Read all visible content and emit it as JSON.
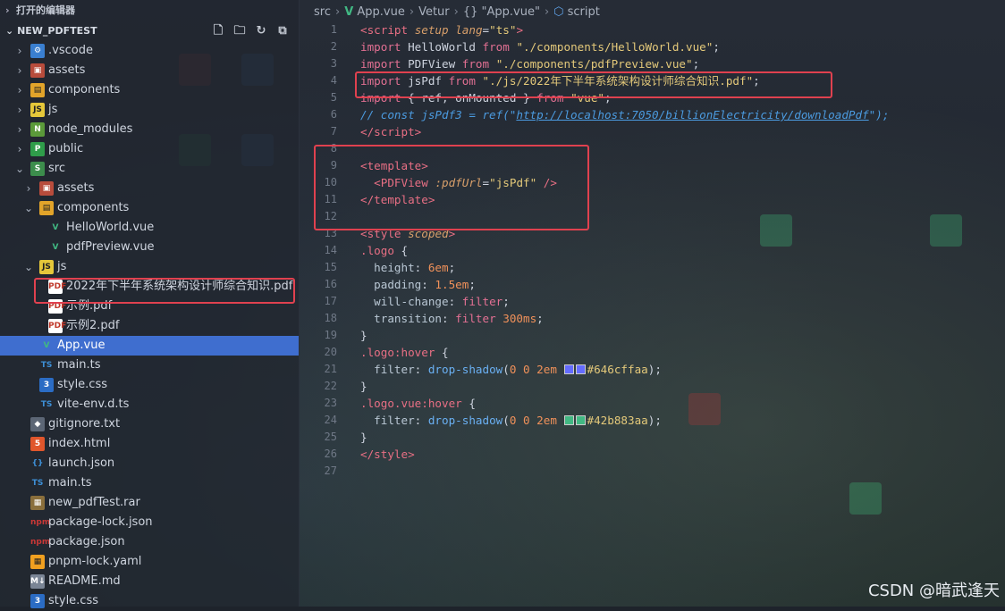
{
  "sidebar": {
    "open_editors_label": "打开的编辑器",
    "project_label": "NEW_PDFTEST",
    "action_icons": [
      "new-file-icon",
      "new-folder-icon",
      "refresh-icon",
      "collapse-all-icon"
    ],
    "items": [
      {
        "label": ".vscode",
        "depth": 0,
        "chev": "›",
        "icon": "vscode"
      },
      {
        "label": "assets",
        "depth": 0,
        "chev": "›",
        "icon": "assets"
      },
      {
        "label": "components",
        "depth": 0,
        "chev": "›",
        "icon": "comp"
      },
      {
        "label": "js",
        "depth": 0,
        "chev": "›",
        "icon": "js"
      },
      {
        "label": "node_modules",
        "depth": 0,
        "chev": "›",
        "icon": "node"
      },
      {
        "label": "public",
        "depth": 0,
        "chev": "›",
        "icon": "public"
      },
      {
        "label": "src",
        "depth": 0,
        "chev": "⌄",
        "icon": "src"
      },
      {
        "label": "assets",
        "depth": 1,
        "chev": "›",
        "icon": "assets"
      },
      {
        "label": "components",
        "depth": 1,
        "chev": "⌄",
        "icon": "comp"
      },
      {
        "label": "HelloWorld.vue",
        "depth": 2,
        "chev": "",
        "icon": "vue"
      },
      {
        "label": "pdfPreview.vue",
        "depth": 2,
        "chev": "",
        "icon": "vue"
      },
      {
        "label": "js",
        "depth": 1,
        "chev": "⌄",
        "icon": "js"
      },
      {
        "label": "2022年下半年系统架构设计师综合知识.pdf",
        "depth": 2,
        "chev": "",
        "icon": "pdf"
      },
      {
        "label": "示例.pdf",
        "depth": 2,
        "chev": "",
        "icon": "pdf"
      },
      {
        "label": "示例2.pdf",
        "depth": 2,
        "chev": "",
        "icon": "pdf"
      },
      {
        "label": "App.vue",
        "depth": 1,
        "chev": "",
        "icon": "vue",
        "selected": true
      },
      {
        "label": "main.ts",
        "depth": 1,
        "chev": "",
        "icon": "ts"
      },
      {
        "label": "style.css",
        "depth": 1,
        "chev": "",
        "icon": "css"
      },
      {
        "label": "vite-env.d.ts",
        "depth": 1,
        "chev": "",
        "icon": "ts"
      },
      {
        "label": "gitignore.txt",
        "depth": 0,
        "chev": "",
        "icon": "git"
      },
      {
        "label": "index.html",
        "depth": 0,
        "chev": "",
        "icon": "html"
      },
      {
        "label": "launch.json",
        "depth": 0,
        "chev": "",
        "icon": "json"
      },
      {
        "label": "main.ts",
        "depth": 0,
        "chev": "",
        "icon": "ts"
      },
      {
        "label": "new_pdfTest.rar",
        "depth": 0,
        "chev": "",
        "icon": "rar"
      },
      {
        "label": "package-lock.json",
        "depth": 0,
        "chev": "",
        "icon": "lock"
      },
      {
        "label": "package.json",
        "depth": 0,
        "chev": "",
        "icon": "lock"
      },
      {
        "label": "pnpm-lock.yaml",
        "depth": 0,
        "chev": "",
        "icon": "yaml"
      },
      {
        "label": "README.md",
        "depth": 0,
        "chev": "",
        "icon": "md"
      },
      {
        "label": "style.css",
        "depth": 0,
        "chev": "",
        "icon": "css"
      }
    ]
  },
  "breadcrumb": {
    "items": [
      "src",
      "App.vue",
      "Vetur",
      "{} \"App.vue\"",
      "script"
    ]
  },
  "editor": {
    "lines": [
      [
        [
          "<",
          "tag"
        ],
        [
          "script",
          "tag"
        ],
        [
          " ",
          ""
        ],
        [
          "setup",
          "attr"
        ],
        [
          " ",
          ""
        ],
        [
          "lang",
          "attr"
        ],
        [
          "=",
          ""
        ],
        [
          "\"ts\"",
          "str"
        ],
        [
          ">",
          "tag"
        ]
      ],
      [
        [
          "import",
          "kw"
        ],
        [
          " HelloWorld ",
          ""
        ],
        [
          "from",
          "kw"
        ],
        [
          " ",
          ""
        ],
        [
          "\"./components/HelloWorld.vue\"",
          "str"
        ],
        [
          ";",
          ""
        ]
      ],
      [
        [
          "import",
          "kw"
        ],
        [
          " PDFView ",
          ""
        ],
        [
          "from",
          "kw"
        ],
        [
          " ",
          ""
        ],
        [
          "\"./components/pdfPreview.vue\"",
          "str"
        ],
        [
          ";",
          ""
        ]
      ],
      [
        [
          "import",
          "kw"
        ],
        [
          " jsPdf ",
          ""
        ],
        [
          "from",
          "kw"
        ],
        [
          " ",
          ""
        ],
        [
          "\"./js/2022年下半年系统架构设计师综合知识.pdf\"",
          "str"
        ],
        [
          ";",
          ""
        ]
      ],
      [
        [
          "import",
          "kw"
        ],
        [
          " { ref, onMounted } ",
          ""
        ],
        [
          "from",
          "kw"
        ],
        [
          " ",
          ""
        ],
        [
          "\"vue\"",
          "str"
        ],
        [
          ";",
          ""
        ]
      ],
      [
        [
          "// const jsPdf3 = ref(\"",
          "cmt"
        ],
        [
          "http://localhost:7050/billionElectricity/downloadPdf",
          "cmt link"
        ],
        [
          "\");",
          "cmt"
        ]
      ],
      [
        [
          "</",
          "tag"
        ],
        [
          "script",
          "tag"
        ],
        [
          ">",
          "tag"
        ]
      ],
      [],
      [
        [
          "<",
          "tag"
        ],
        [
          "template",
          "tag"
        ],
        [
          ">",
          "tag"
        ]
      ],
      [
        [
          "  ",
          ""
        ],
        [
          "<",
          "tag"
        ],
        [
          "PDFView",
          "tag"
        ],
        [
          " ",
          ""
        ],
        [
          ":pdfUrl",
          "attr"
        ],
        [
          "=",
          ""
        ],
        [
          "\"jsPdf\"",
          "str"
        ],
        [
          " />",
          "tag"
        ]
      ],
      [
        [
          "</",
          "tag"
        ],
        [
          "template",
          "tag"
        ],
        [
          ">",
          "tag"
        ]
      ],
      [],
      [
        [
          "<",
          "tag"
        ],
        [
          "style",
          "tag"
        ],
        [
          " ",
          ""
        ],
        [
          "scoped",
          "attr"
        ],
        [
          ">",
          "tag"
        ]
      ],
      [
        [
          ".logo",
          "sel"
        ],
        [
          " {",
          ""
        ]
      ],
      [
        [
          "  ",
          ""
        ],
        [
          "height",
          "prop"
        ],
        [
          ": ",
          ""
        ],
        [
          "6em",
          "num"
        ],
        [
          ";",
          ""
        ]
      ],
      [
        [
          "  ",
          ""
        ],
        [
          "padding",
          "prop"
        ],
        [
          ": ",
          ""
        ],
        [
          "1.5em",
          "num"
        ],
        [
          ";",
          ""
        ]
      ],
      [
        [
          "  ",
          ""
        ],
        [
          "will-change",
          "prop"
        ],
        [
          ": ",
          ""
        ],
        [
          "filter",
          "val"
        ],
        [
          ";",
          ""
        ]
      ],
      [
        [
          "  ",
          ""
        ],
        [
          "transition",
          "prop"
        ],
        [
          ": ",
          ""
        ],
        [
          "filter ",
          "val"
        ],
        [
          "300ms",
          "num"
        ],
        [
          ";",
          ""
        ]
      ],
      [
        [
          "}",
          ""
        ]
      ],
      [
        [
          ".logo",
          "sel"
        ],
        [
          ":hover",
          "sel"
        ],
        [
          " {",
          ""
        ]
      ],
      [
        [
          "  ",
          ""
        ],
        [
          "filter",
          "prop"
        ],
        [
          ": ",
          ""
        ],
        [
          "drop-shadow",
          "fn"
        ],
        [
          "(",
          ""
        ],
        [
          "0 0 2em ",
          "num"
        ],
        [
          "#646cffaa",
          "swatch:#646cff"
        ],
        [
          ");",
          ""
        ]
      ],
      [
        [
          "}",
          ""
        ]
      ],
      [
        [
          ".logo.vue",
          "sel"
        ],
        [
          ":hover",
          "sel"
        ],
        [
          " {",
          ""
        ]
      ],
      [
        [
          "  ",
          ""
        ],
        [
          "filter",
          "prop"
        ],
        [
          ": ",
          ""
        ],
        [
          "drop-shadow",
          "fn"
        ],
        [
          "(",
          ""
        ],
        [
          "0 0 2em ",
          "num"
        ],
        [
          "#42b883aa",
          "swatch:#42b883"
        ],
        [
          ");",
          ""
        ]
      ],
      [
        [
          "}",
          ""
        ]
      ],
      [
        [
          "</",
          "tag"
        ],
        [
          "style",
          "tag"
        ],
        [
          ">",
          "tag"
        ]
      ],
      []
    ]
  },
  "colors": {
    "highlight_box": "#e0414f",
    "selection": "#3f6ecf",
    "vue_green": "#41b883"
  },
  "watermark": "CSDN @暗武逢天"
}
